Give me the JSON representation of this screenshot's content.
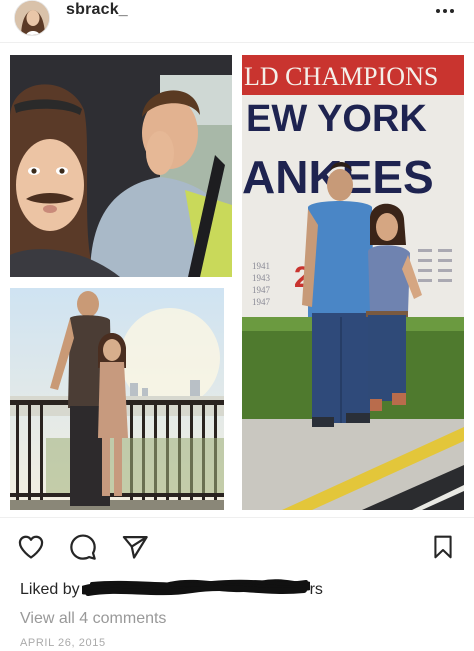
{
  "header": {
    "username": "sbrack_",
    "avatar_icon": "profile-avatar",
    "more_icon": "more-options-icon"
  },
  "photos": {
    "yankees_sign": {
      "line1": "LD CHAMPIONS",
      "line2": "EW YORK",
      "line3": "ANKEES",
      "years_left": [
        "1941",
        "1943",
        "1947",
        "1947"
      ],
      "digit": "2"
    }
  },
  "actions": {
    "like_icon": "heart-outline-icon",
    "comment_icon": "speech-bubble-icon",
    "share_icon": "paper-plane-icon",
    "save_icon": "bookmark-icon"
  },
  "likes": {
    "prefix": "Liked by",
    "suffix": "rs"
  },
  "comments": {
    "view_all": "View all 4 comments"
  },
  "post_date": "APRIL 26, 2015",
  "colors": {
    "text_primary": "#262626",
    "text_secondary": "#999999",
    "date_text": "#aaaaaa",
    "sign_navy": "#1e2350",
    "shirt_blue": "#4a86c6"
  }
}
